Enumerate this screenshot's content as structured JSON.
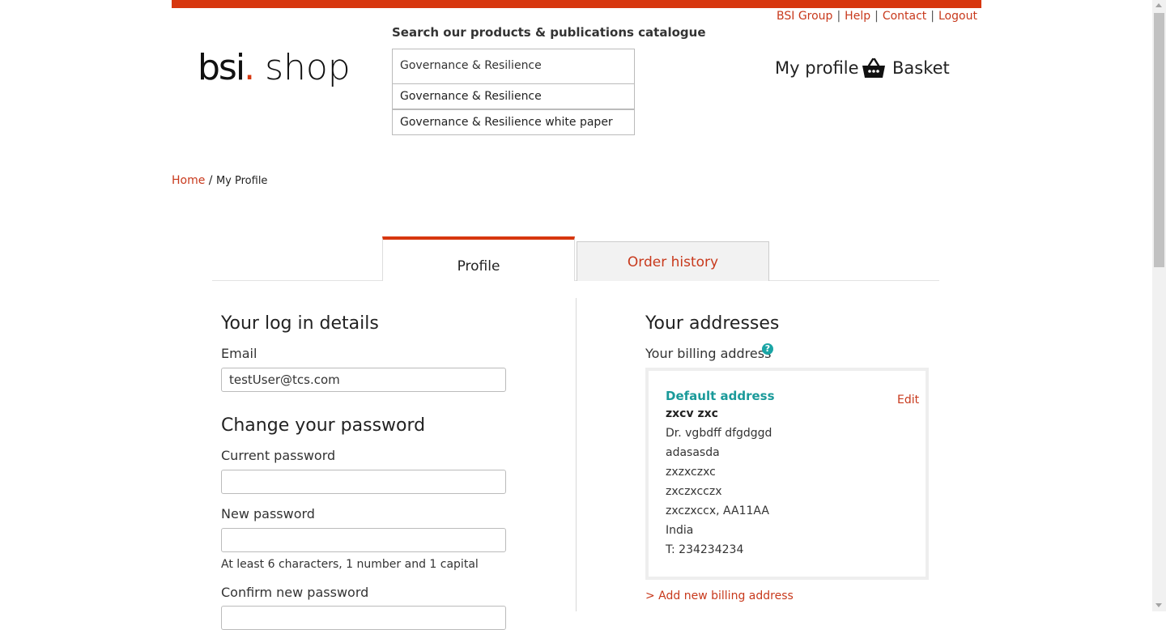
{
  "colors": {
    "accent": "#d7370f",
    "link": "#c8391c",
    "teal": "#1a9a9a"
  },
  "top_links": {
    "bsi_group": "BSI Group",
    "help": "Help",
    "contact": "Contact",
    "logout": "Logout",
    "separator": "|"
  },
  "logo": {
    "brand": "bsi",
    "dot": ".",
    "shop": "shop"
  },
  "search": {
    "label": "Search our products & publications catalogue",
    "value": "Governance & Resilience",
    "suggestions": [
      "Governance & Resilience",
      "Governance & Resilience white paper"
    ]
  },
  "header_nav": {
    "my_profile": "My profile",
    "basket": "Basket",
    "basket_icon": "basket-icon"
  },
  "breadcrumb": {
    "home": "Home",
    "separator": "/",
    "current": "My Profile"
  },
  "tabs": {
    "profile": "Profile",
    "order_history": "Order history"
  },
  "login": {
    "heading": "Your log in details",
    "email_label": "Email",
    "email_value": "testUser@tcs.com"
  },
  "password": {
    "heading": "Change your password",
    "current_label": "Current password",
    "new_label": "New password",
    "hint": "At least 6 characters, 1 number and 1 capital",
    "confirm_label": "Confirm new password"
  },
  "addresses": {
    "heading": "Your addresses",
    "billing_label": "Your billing address",
    "help_icon": "?",
    "default_title": "Default address",
    "edit": "Edit",
    "name": "zxcv zxc",
    "lines": [
      "Dr. vgbdff dfgdggd",
      "adasasda",
      "zxzxczxc",
      "zxczxcczx",
      "zxczxccx, AA11AA",
      "India",
      "T: 234234234"
    ],
    "add_link": "> Add new billing address"
  }
}
